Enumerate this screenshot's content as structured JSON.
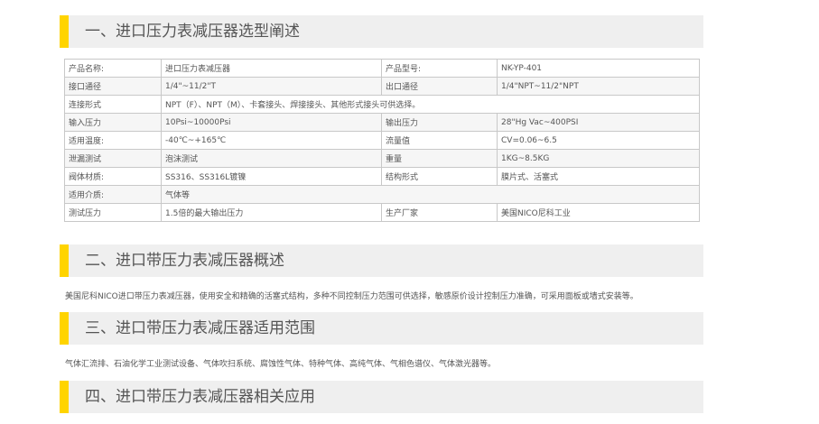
{
  "sections": [
    {
      "title": "一、进口压力表减压器选型阐述"
    },
    {
      "title": "二、进口带压力表减压器概述"
    },
    {
      "title": "三、进口带压力表减压器适用范围"
    },
    {
      "title": "四、进口带压力表减压器相关应用"
    }
  ],
  "spec": {
    "rows": [
      [
        "产品名称:",
        "进口压力表减压器",
        "产品型号:",
        "NK-YP-401"
      ],
      [
        "接口通径",
        "1/4\"~11/2\"T",
        "出口通径",
        "1/4\"NPT~11/2\"NPT"
      ],
      [
        "连接形式",
        "NPT（F）、NPT（M）、卡套接头、焊接接头、其他形式接头可供选择。"
      ],
      [
        "输入压力",
        "10Psi~10000Psi",
        "输出压力",
        "28\"Hg Vac~400PSI"
      ],
      [
        "适用温度:",
        "-40℃~+165℃",
        "流量值",
        "CV=0.06~6.5"
      ],
      [
        "泄漏测试",
        "泡沫测试",
        "重量",
        "1KG~8.5KG"
      ],
      [
        "阀体材质:",
        "SS316、SS316L镀镍",
        "结构形式",
        "膜片式、活塞式"
      ],
      [
        "适用介质:",
        "气体等"
      ],
      [
        "测试压力",
        "1.5倍的最大输出压力",
        "生产厂家",
        "美国NICO尼科工业"
      ]
    ]
  },
  "overview_text": "美国尼科NICO进口带压力表减压器，使用安全和精确的活塞式结构，多种不同控制压力范围可供选择，敏感原价设计控制压力准确，可采用面板或墙式安装等。",
  "scope_text": "气体汇流排、石油化学工业测试设备、气体吹扫系统、腐蚀性气体、特种气体、高纯气体、气相色谱仪、气体激光器等。"
}
